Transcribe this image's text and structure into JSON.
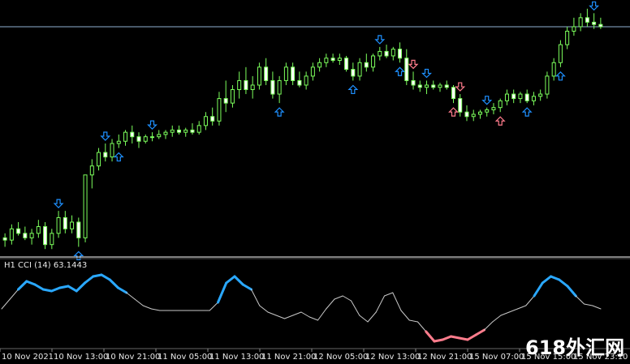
{
  "indicator": {
    "label": "H1 CCI (14) 63.1443"
  },
  "time_axis": {
    "labels": [
      "10 Nov 2021",
      "10 Nov 13:00",
      "10 Nov 21:00",
      "11 Nov 05:00",
      "11 Nov 13:00",
      "11 Nov 21:00",
      "12 Nov 05:00",
      "12 Nov 13:00",
      "12 Nov 21:00",
      "15 Nov 07:00",
      "15 Nov 15:00",
      "15 Nov 23:10"
    ]
  },
  "watermark": {
    "text": "618外汇网"
  },
  "colors": {
    "background": "#000000",
    "candle": "#7cff5c",
    "arrow_down": "#1e90ff",
    "arrow_up": "#1e90ff",
    "arrow_pink": "#ff7c8c",
    "cci_high": "#2aa8ff",
    "cci_low": "#ff7c8c",
    "cci_mid": "#c8c8c8",
    "hline": "#8fb0d0",
    "separator": "#ffffff"
  },
  "chart_data": [
    {
      "type": "candlestick",
      "series": [
        {
          "values": [
            [
              0.1,
              0.12,
              0.06,
              0.09
            ],
            [
              0.09,
              0.16,
              0.07,
              0.14
            ],
            [
              0.14,
              0.17,
              0.11,
              0.12
            ],
            [
              0.12,
              0.15,
              0.09,
              0.1
            ],
            [
              0.1,
              0.14,
              0.07,
              0.12
            ],
            [
              0.12,
              0.18,
              0.1,
              0.15
            ],
            [
              0.15,
              0.17,
              0.05,
              0.07
            ],
            [
              0.07,
              0.14,
              0.05,
              0.12
            ],
            [
              0.12,
              0.22,
              0.1,
              0.19
            ],
            [
              0.19,
              0.22,
              0.12,
              0.14
            ],
            [
              0.14,
              0.2,
              0.12,
              0.17
            ],
            [
              0.17,
              0.19,
              0.06,
              0.1
            ],
            [
              0.1,
              0.34,
              0.08,
              0.38
            ],
            [
              0.38,
              0.45,
              0.32,
              0.42
            ],
            [
              0.42,
              0.5,
              0.4,
              0.48
            ],
            [
              0.48,
              0.52,
              0.44,
              0.46
            ],
            [
              0.46,
              0.54,
              0.44,
              0.52
            ],
            [
              0.52,
              0.56,
              0.5,
              0.53
            ],
            [
              0.53,
              0.58,
              0.51,
              0.57
            ],
            [
              0.57,
              0.6,
              0.52,
              0.55
            ],
            [
              0.55,
              0.57,
              0.5,
              0.53
            ],
            [
              0.53,
              0.56,
              0.52,
              0.55
            ],
            [
              0.55,
              0.57,
              0.53,
              0.55
            ],
            [
              0.55,
              0.58,
              0.54,
              0.56
            ],
            [
              0.56,
              0.58,
              0.54,
              0.57
            ],
            [
              0.57,
              0.6,
              0.55,
              0.58
            ],
            [
              0.58,
              0.6,
              0.56,
              0.57
            ],
            [
              0.57,
              0.59,
              0.55,
              0.58
            ],
            [
              0.58,
              0.61,
              0.56,
              0.57
            ],
            [
              0.57,
              0.62,
              0.56,
              0.6
            ],
            [
              0.6,
              0.66,
              0.58,
              0.64
            ],
            [
              0.64,
              0.68,
              0.6,
              0.62
            ],
            [
              0.62,
              0.75,
              0.6,
              0.72
            ],
            [
              0.72,
              0.8,
              0.66,
              0.7
            ],
            [
              0.7,
              0.78,
              0.68,
              0.76
            ],
            [
              0.76,
              0.84,
              0.72,
              0.8
            ],
            [
              0.8,
              0.86,
              0.74,
              0.76
            ],
            [
              0.76,
              0.82,
              0.72,
              0.78
            ],
            [
              0.78,
              0.88,
              0.76,
              0.86
            ],
            [
              0.86,
              0.9,
              0.78,
              0.8
            ],
            [
              0.8,
              0.84,
              0.72,
              0.74
            ],
            [
              0.74,
              0.82,
              0.7,
              0.8
            ],
            [
              0.8,
              0.88,
              0.78,
              0.86
            ],
            [
              0.86,
              0.88,
              0.78,
              0.8
            ],
            [
              0.8,
              0.84,
              0.77,
              0.78
            ],
            [
              0.78,
              0.84,
              0.76,
              0.82
            ],
            [
              0.82,
              0.88,
              0.8,
              0.86
            ],
            [
              0.86,
              0.9,
              0.84,
              0.88
            ],
            [
              0.88,
              0.92,
              0.86,
              0.9
            ],
            [
              0.9,
              0.92,
              0.88,
              0.89
            ],
            [
              0.89,
              0.92,
              0.87,
              0.9
            ],
            [
              0.9,
              0.91,
              0.84,
              0.85
            ],
            [
              0.85,
              0.88,
              0.8,
              0.82
            ],
            [
              0.82,
              0.9,
              0.8,
              0.88
            ],
            [
              0.88,
              0.92,
              0.84,
              0.86
            ],
            [
              0.86,
              0.92,
              0.84,
              0.91
            ],
            [
              0.91,
              0.95,
              0.89,
              0.93
            ],
            [
              0.93,
              0.96,
              0.9,
              0.91
            ],
            [
              0.91,
              0.95,
              0.89,
              0.94
            ],
            [
              0.94,
              0.97,
              0.88,
              0.9
            ],
            [
              0.9,
              0.94,
              0.78,
              0.8
            ],
            [
              0.8,
              0.84,
              0.76,
              0.78
            ],
            [
              0.78,
              0.8,
              0.75,
              0.77
            ],
            [
              0.77,
              0.8,
              0.74,
              0.78
            ],
            [
              0.78,
              0.8,
              0.76,
              0.77
            ],
            [
              0.77,
              0.79,
              0.75,
              0.78
            ],
            [
              0.78,
              0.8,
              0.76,
              0.77
            ],
            [
              0.77,
              0.78,
              0.7,
              0.72
            ],
            [
              0.72,
              0.74,
              0.64,
              0.66
            ],
            [
              0.66,
              0.69,
              0.62,
              0.64
            ],
            [
              0.64,
              0.67,
              0.62,
              0.65
            ],
            [
              0.65,
              0.67,
              0.63,
              0.66
            ],
            [
              0.66,
              0.68,
              0.64,
              0.67
            ],
            [
              0.67,
              0.7,
              0.65,
              0.68
            ],
            [
              0.68,
              0.72,
              0.66,
              0.71
            ],
            [
              0.71,
              0.76,
              0.69,
              0.74
            ],
            [
              0.74,
              0.76,
              0.7,
              0.72
            ],
            [
              0.72,
              0.75,
              0.7,
              0.74
            ],
            [
              0.74,
              0.76,
              0.7,
              0.71
            ],
            [
              0.71,
              0.75,
              0.69,
              0.73
            ],
            [
              0.73,
              0.76,
              0.71,
              0.74
            ],
            [
              0.74,
              0.84,
              0.72,
              0.82
            ],
            [
              0.82,
              0.9,
              0.8,
              0.88
            ],
            [
              0.88,
              0.98,
              0.86,
              0.96
            ],
            [
              0.96,
              1.04,
              0.94,
              1.02
            ],
            [
              1.02,
              1.08,
              1.0,
              1.04
            ],
            [
              1.04,
              1.1,
              1.02,
              1.08
            ],
            [
              1.08,
              1.12,
              1.04,
              1.06
            ],
            [
              1.06,
              1.1,
              1.03,
              1.05
            ],
            [
              1.05,
              1.08,
              1.03,
              1.04
            ]
          ]
        }
      ]
    },
    {
      "type": "line",
      "series": [
        {
          "values": [
            -40,
            20,
            80,
            130,
            110,
            80,
            70,
            90,
            100,
            70,
            120,
            160,
            170,
            140,
            90,
            60,
            20,
            -20,
            -40,
            -50,
            -50,
            -50,
            -50,
            -50,
            -50,
            -50,
            0,
            120,
            160,
            110,
            80,
            -20,
            -60,
            -80,
            -100,
            -80,
            -60,
            -90,
            -110,
            -40,
            20,
            40,
            10,
            -80,
            -120,
            -60,
            40,
            60,
            -50,
            -110,
            -120,
            -180,
            -240,
            -230,
            -210,
            -220,
            -230,
            -200,
            -170,
            -120,
            -80,
            -60,
            -40,
            -20,
            40,
            120,
            160,
            140,
            100,
            40,
            -10,
            -20,
            -40
          ]
        }
      ]
    }
  ]
}
